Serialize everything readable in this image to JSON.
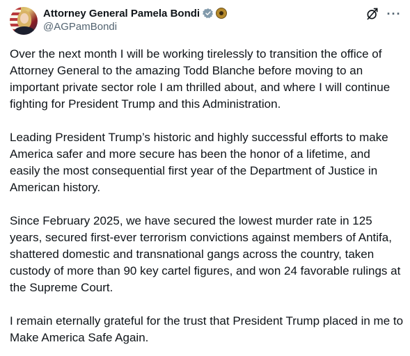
{
  "author": {
    "display_name": "Attorney General Pamela Bondi",
    "handle": "@AGPamBondi"
  },
  "icons": {
    "verified": "verified-check-icon",
    "affiliate": "doj-seal-icon",
    "grok": "grok-icon",
    "more": "more-options-icon",
    "more_glyph": "···"
  },
  "colors": {
    "text": "#0f1419",
    "secondary_text": "#536471",
    "verified_badge": "#829aab"
  },
  "post": {
    "paragraphs": [
      "Over the next month I will be working tirelessly to transition the office of Attorney General to the amazing Todd Blanche before moving to an important private sector role I am thrilled about, and where I will continue fighting for President Trump and this Administration.",
      "Leading President Trump’s historic and highly successful efforts to make America safer and more secure has been the honor of a lifetime, and easily the most consequential first year of the Department of Justice in American history.",
      "Since February 2025, we have secured the lowest murder rate in 125 years, secured first-ever terrorism convictions against members of Antifa, shattered domestic and transnational gangs across the country, taken custody of more than 90 key cartel figures, and won 24 favorable rulings at the Supreme Court.",
      "I remain eternally grateful for the trust that President Trump placed in me to Make America Safe Again."
    ]
  }
}
